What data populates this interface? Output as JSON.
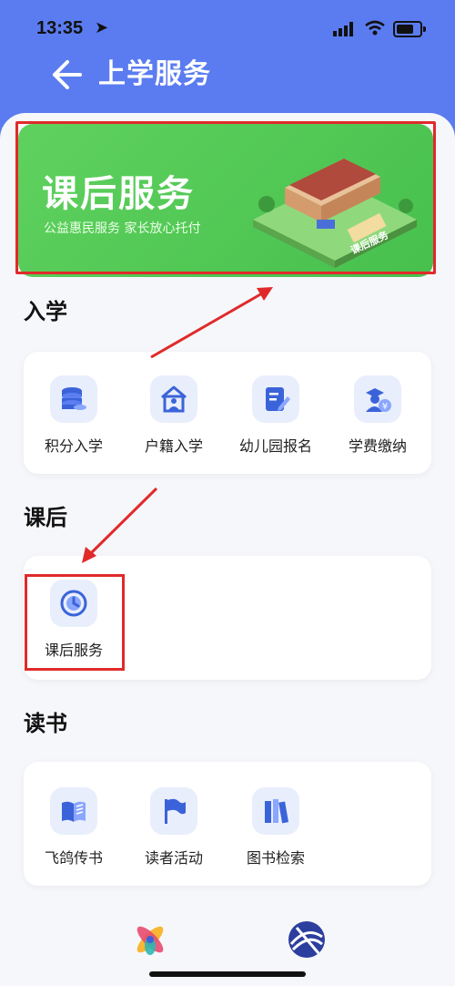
{
  "status": {
    "time": "13:35"
  },
  "header": {
    "title": "上学服务"
  },
  "banner": {
    "title": "课后服务",
    "subtitle": "公益惠民服务  家长放心托付",
    "sign": "课后服务"
  },
  "sections": [
    {
      "title": "入学",
      "items": [
        {
          "label": "积分入学",
          "icon": "coins-stack-icon"
        },
        {
          "label": "户籍入学",
          "icon": "house-person-icon"
        },
        {
          "label": "幼儿园报名",
          "icon": "form-edit-icon"
        },
        {
          "label": "学费缴纳",
          "icon": "graduate-yen-icon"
        }
      ]
    },
    {
      "title": "课后",
      "items": [
        {
          "label": "课后服务",
          "icon": "clock-icon"
        }
      ]
    },
    {
      "title": "读书",
      "items": [
        {
          "label": "飞鸽传书",
          "icon": "open-book-icon"
        },
        {
          "label": "读者活动",
          "icon": "flag-icon"
        },
        {
          "label": "图书检索",
          "icon": "books-icon"
        }
      ]
    }
  ],
  "colors": {
    "primary": "#5b7cf0",
    "highlight": "#e02a2a",
    "banner": "#55c957"
  }
}
